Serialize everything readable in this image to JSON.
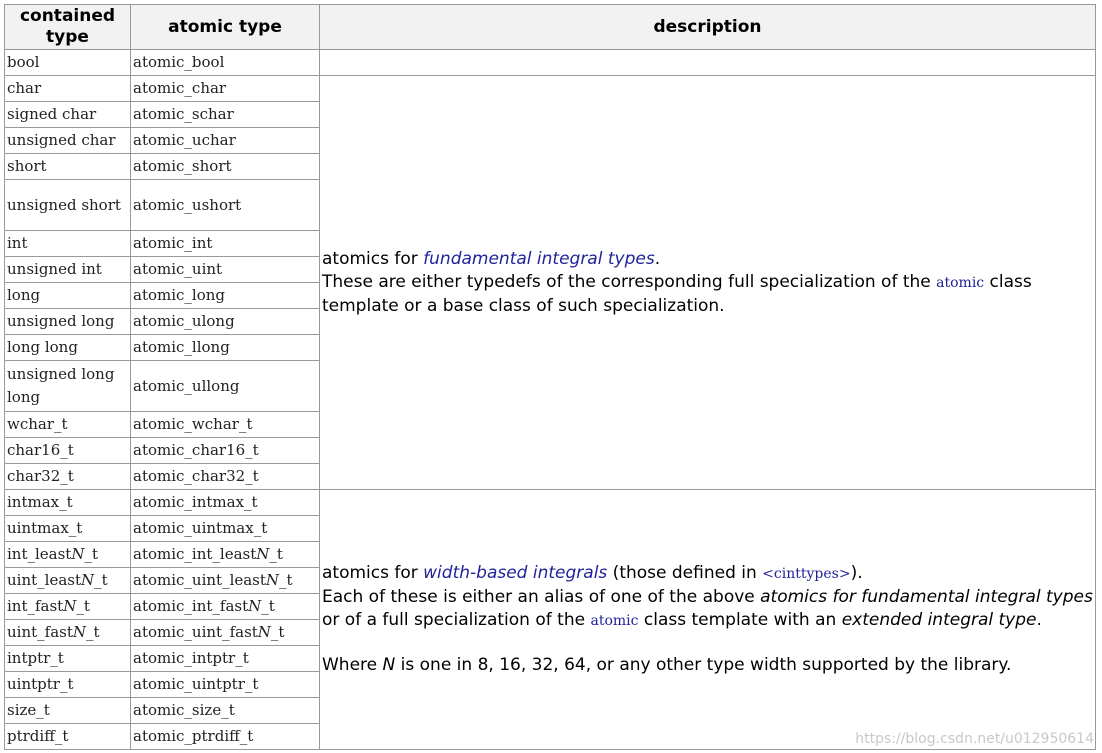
{
  "headers": {
    "contained": "contained type",
    "atomic": "atomic type",
    "description": "description"
  },
  "bool_row": {
    "contained": "bool",
    "atomic": "atomic_bool"
  },
  "fundamental_rows": [
    {
      "contained": "char",
      "atomic": "atomic_char"
    },
    {
      "contained": "signed char",
      "atomic": "atomic_schar"
    },
    {
      "contained": "unsigned char",
      "atomic": "atomic_uchar"
    },
    {
      "contained": "short",
      "atomic": "atomic_short"
    },
    {
      "contained": "unsigned short",
      "atomic": "atomic_ushort"
    },
    {
      "contained": "int",
      "atomic": "atomic_int"
    },
    {
      "contained": "unsigned int",
      "atomic": "atomic_uint"
    },
    {
      "contained": "long",
      "atomic": "atomic_long"
    },
    {
      "contained": "unsigned long",
      "atomic": "atomic_ulong"
    },
    {
      "contained": "long long",
      "atomic": "atomic_llong"
    },
    {
      "contained": "unsigned long long",
      "atomic": "atomic_ullong"
    },
    {
      "contained": "wchar_t",
      "atomic": "atomic_wchar_t"
    },
    {
      "contained": "char16_t",
      "atomic": "atomic_char16_t"
    },
    {
      "contained": "char32_t",
      "atomic": "atomic_char32_t"
    }
  ],
  "width_rows": [
    {
      "contained": "intmax_t",
      "atomic": "atomic_intmax_t"
    },
    {
      "contained": "uintmax_t",
      "atomic": "atomic_uintmax_t"
    },
    {
      "c_pre": "int_least",
      "c_n": "N",
      "c_post": "_t",
      "a_pre": "atomic_int_least",
      "a_n": "N",
      "a_post": "_t"
    },
    {
      "c_pre": "uint_least",
      "c_n": "N",
      "c_post": "_t",
      "a_pre": "atomic_uint_least",
      "a_n": "N",
      "a_post": "_t"
    },
    {
      "c_pre": "int_fast",
      "c_n": "N",
      "c_post": "_t",
      "a_pre": "atomic_int_fast",
      "a_n": "N",
      "a_post": "_t"
    },
    {
      "c_pre": "uint_fast",
      "c_n": "N",
      "c_post": "_t",
      "a_pre": "atomic_uint_fast",
      "a_n": "N",
      "a_post": "_t"
    },
    {
      "contained": "intptr_t",
      "atomic": "atomic_intptr_t"
    },
    {
      "contained": "uintptr_t",
      "atomic": "atomic_uintptr_t"
    },
    {
      "contained": "size_t",
      "atomic": "atomic_size_t"
    },
    {
      "contained": "ptrdiff_t",
      "atomic": "atomic_ptrdiff_t"
    }
  ],
  "desc_fundamental": {
    "p1_pre": "atomics for ",
    "p1_link": "fundamental integral types",
    "p1_post": ".",
    "p2_pre": "These are either typedefs of the corresponding full specialization of the ",
    "p2_code": "atomic",
    "p2_post": " class template or a base class of such specialization."
  },
  "desc_width": {
    "p1_pre": "atomics for ",
    "p1_link": "width-based integrals",
    "p1_mid": " (those defined in ",
    "p1_code": "<cinttypes>",
    "p1_post": ").",
    "p2_a": "Each of these is either an alias of one of the above ",
    "p2_b": "atomics for fundamental integral types",
    "p2_c": " or of a full specialization of the ",
    "p2_code": "atomic",
    "p2_d": " class template with an ",
    "p2_e": "extended integral type",
    "p2_f": ".",
    "p3_a": "Where ",
    "p3_n": "N",
    "p3_b": " is one in 8, 16, 32, 64, or any other type width supported by the library."
  },
  "watermark": "https://blog.csdn.net/u012950614"
}
